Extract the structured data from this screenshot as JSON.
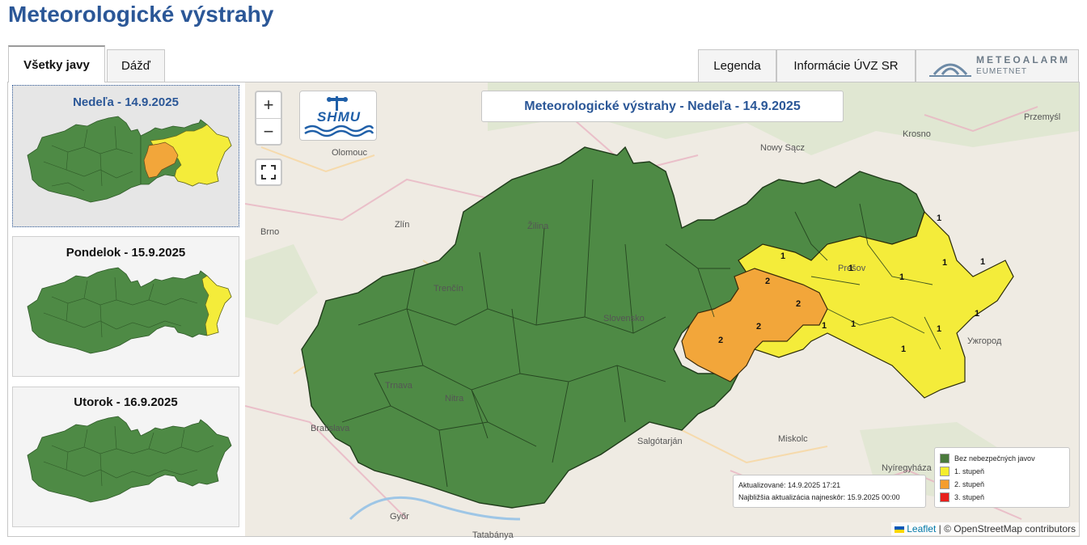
{
  "page_title": "Meteorologické výstrahy",
  "tabs": [
    {
      "label": "Všetky javy",
      "active": true
    },
    {
      "label": "Dážď",
      "active": false
    }
  ],
  "right_tabs": {
    "legend": "Legenda",
    "info": "Informácie ÚVZ SR"
  },
  "meteoalarm": {
    "line1": "METEOALARM",
    "line2": "EUMETNET"
  },
  "days": [
    {
      "label": "Nedeľa - 14.9.2025",
      "selected": true
    },
    {
      "label": "Pondelok - 15.9.2025",
      "selected": false
    },
    {
      "label": "Utorok - 16.9.2025",
      "selected": false
    }
  ],
  "map": {
    "title": "Meteorologické výstrahy - Nedeľa - 14.9.2025",
    "zoom_in": "+",
    "zoom_out": "−",
    "logo_text": "SHMU",
    "updated": "Aktualizované: 14.9.2025 17:21",
    "next_update": "Najbližšia aktualizácia najneskôr: 15.9.2025 00:00",
    "attribution_leaflet": "Leaflet",
    "attribution_osm": "| © OpenStreetMap contributors",
    "cities": [
      "Olomouc",
      "Nowy Sącz",
      "Krosno",
      "Przemyśl",
      "Brno",
      "Zlín",
      "Žilina",
      "Trenčín",
      "Slovensko",
      "Prešov",
      "Ужгород",
      "Trnava",
      "Nitra",
      "Bratislava",
      "Salgótarján",
      "Miskolc",
      "Nyíregyháza",
      "Győr",
      "Tatabánya"
    ],
    "warning_labels": [
      "1",
      "1",
      "1",
      "1",
      "1",
      "1",
      "2",
      "2",
      "2",
      "2",
      "1",
      "1",
      "1",
      "1",
      "1"
    ]
  },
  "legend": {
    "items": [
      {
        "label": "Bez nebezpečných javov",
        "color": "#4a7a3c"
      },
      {
        "label": "1. stupeň",
        "color": "#f5ee2d"
      },
      {
        "label": "2. stupeň",
        "color": "#f59d2d"
      },
      {
        "label": "3. stupeň",
        "color": "#e8201c"
      }
    ]
  },
  "colors": {
    "green": "#4e8a45",
    "yellow": "#f4ec3a",
    "orange": "#f2a63a",
    "accent": "#2b5797"
  }
}
